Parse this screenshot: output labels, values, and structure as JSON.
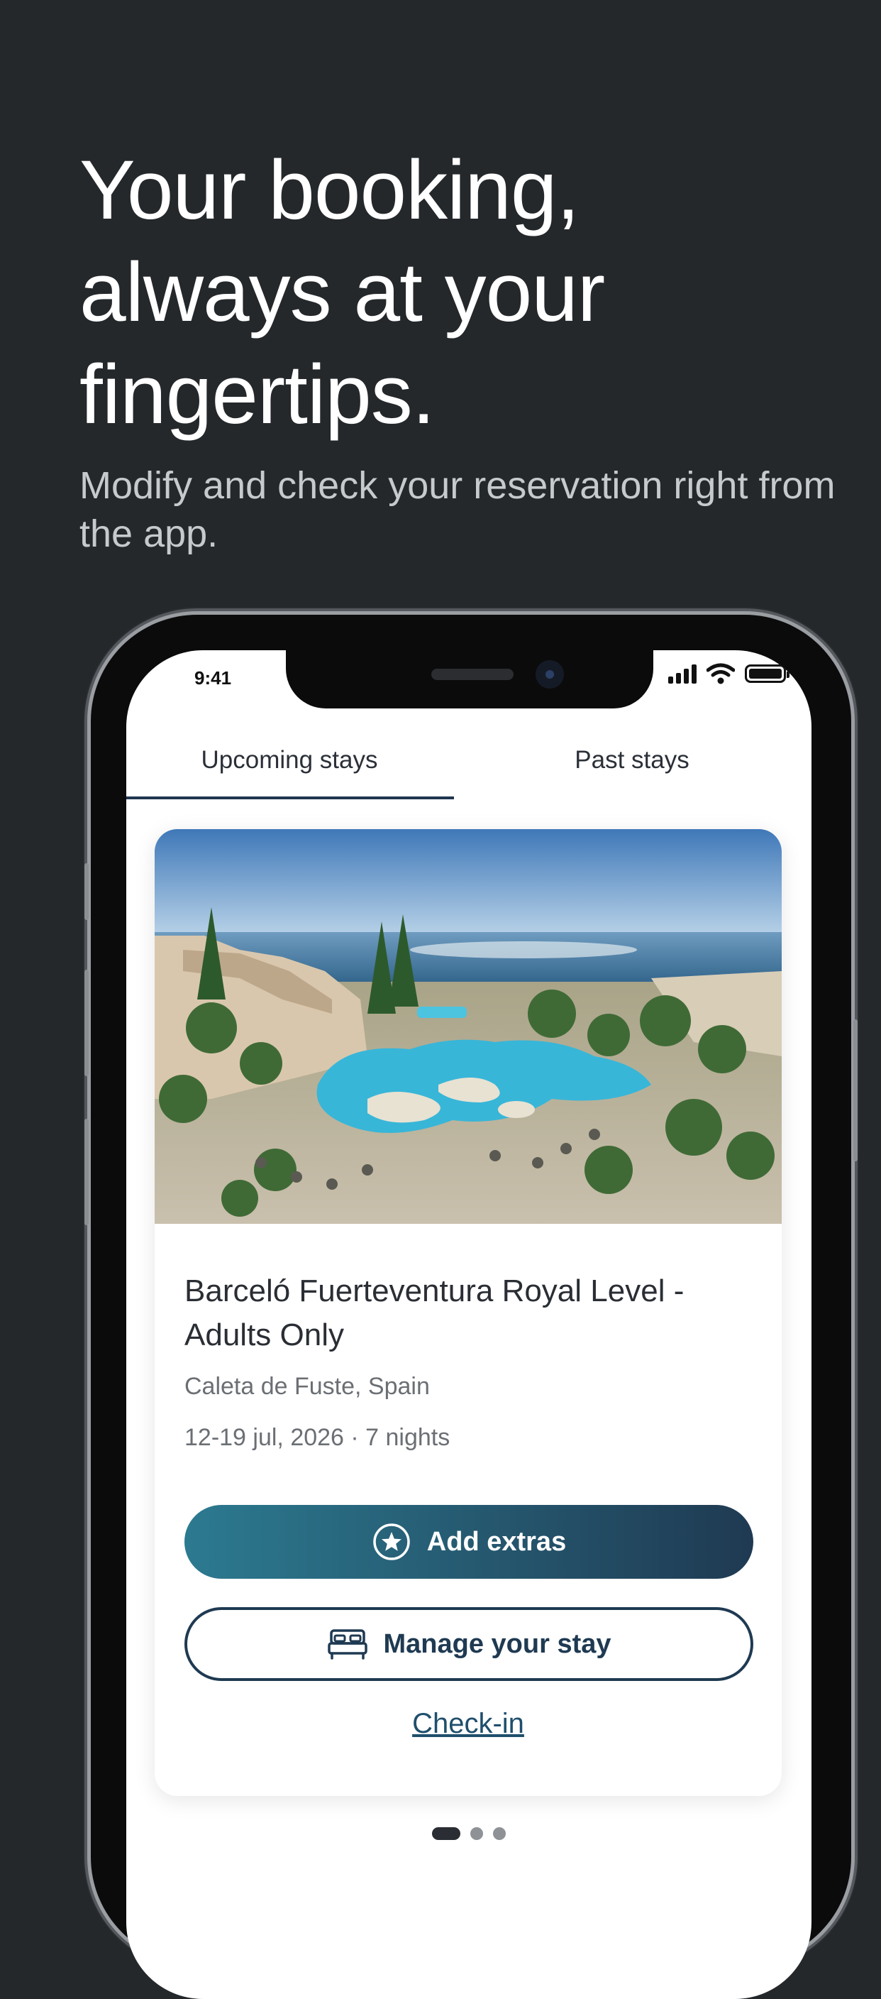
{
  "hero": {
    "headline_line1": "Your booking,",
    "headline_line2": "always at your",
    "headline_line3": "fingertips.",
    "subheadline": "Modify and check your reservation right from the app."
  },
  "status_bar": {
    "time": "9:41"
  },
  "tabs": [
    {
      "label": "Upcoming stays",
      "selected": true
    },
    {
      "label": "Past stays",
      "selected": false
    }
  ],
  "booking": {
    "hotel_name": "Barceló Fuerteventura Royal Level - Adults Only",
    "location": "Caleta de Fuste, Spain",
    "dates": "12-19 jul, 2026 · 7 nights",
    "add_extras_label": "Add extras",
    "manage_label": "Manage your stay",
    "checkin_label": "Check-in"
  },
  "pagination": {
    "current": 1,
    "total": 3
  },
  "colors": {
    "background": "#24282b",
    "accent_start": "#2c7a90",
    "accent_end": "#1f3a52"
  },
  "icons": [
    "star-circle-icon",
    "bed-icon",
    "signal-icon",
    "wifi-icon",
    "battery-icon"
  ]
}
